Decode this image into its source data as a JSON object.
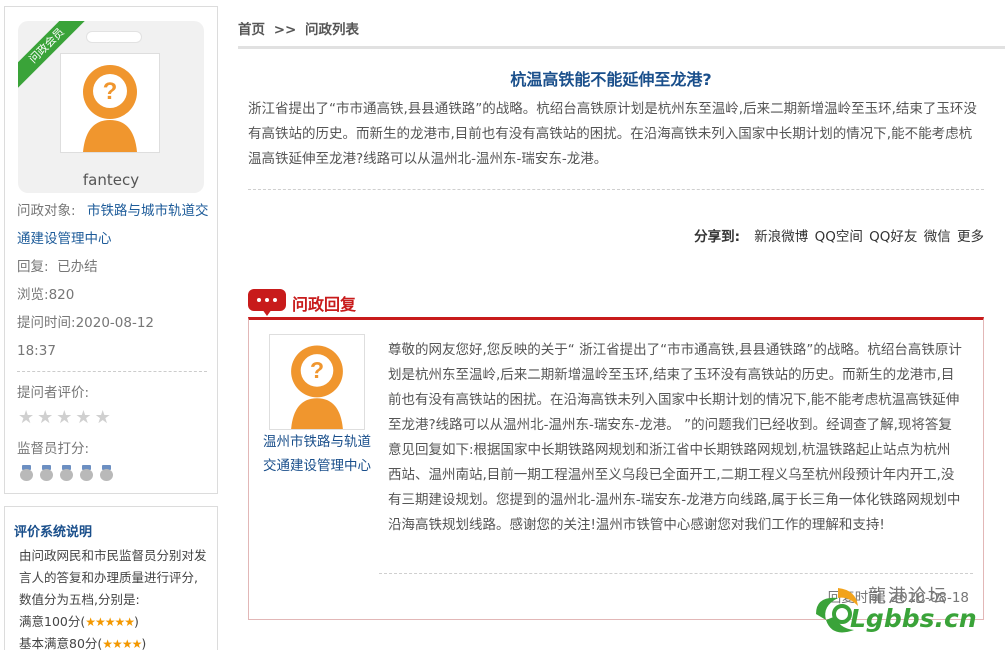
{
  "profile": {
    "badge": "问政会员",
    "username": "fantecy",
    "target_label": "问政对象:",
    "target_value": "市铁路与城市轨道交通建设管理中心",
    "reply_label": "回复:",
    "reply_value": "已办结",
    "views_label": "浏览:",
    "views_value": "820",
    "time_label": "提问时间:",
    "time_value": "2020-08-12 18:37",
    "asker_rating_label": "提问者评价:",
    "supervisor_rating_label": "监督员打分:"
  },
  "rules": {
    "title": "评价系统说明",
    "lines": [
      "由问政网民和市民监督员分别对发",
      "言人的答复和办理质量进行评分,",
      "数值分为五档,分别是:",
      "满意100分(★★★★★)",
      "基本满意80分(★★★★)"
    ]
  },
  "breadcrumb": {
    "home": "首页",
    "sep": ">>",
    "current": "问政列表"
  },
  "question": {
    "title": "杭温高铁能不能延伸至龙港?",
    "body": "浙江省提出了“市市通高铁,县县通铁路”的战略。杭绍台高铁原计划是杭州东至温岭,后来二期新增温岭至玉环,结束了玉环没有高铁站的历史。而新生的龙港市,目前也有没有高铁站的困扰。在沿海高铁未列入国家中长期计划的情况下,能不能考虑杭温高铁延伸至龙港?线路可以从温州北-温州东-瑞安东-龙港。"
  },
  "share": {
    "label": "分享到:",
    "items": [
      "新浪微博",
      "QQ空间",
      "QQ好友",
      "微信",
      "更多"
    ]
  },
  "reply": {
    "heading": "问政回复",
    "org_name": "温州市铁路与轨道交通建设管理中心",
    "body": "尊敬的网友您好,您反映的关于“ 浙江省提出了“市市通高铁,县县通铁路”的战略。杭绍台高铁原计划是杭州东至温岭,后来二期新增温岭至玉环,结束了玉环没有高铁站的历史。而新生的龙港市,目前也有没有高铁站的困扰。在沿海高铁未列入国家中长期计划的情况下,能不能考虑杭温高铁延伸至龙港?线路可以从温州北-温州东-瑞安东-龙港。 ”的问题我们已经收到。经调查了解,现将答复意见回复如下:根据国家中长期铁路网规划和浙江省中长期铁路网规划,杭温铁路起止站点为杭州西站、温州南站,目前一期工程温州至义乌段已全面开工,二期工程义乌至杭州段预计年内开工,没有三期建设规划。您提到的温州北-温州东-瑞安东-龙港方向线路,属于长三角一体化铁路网规划中沿海高铁规划线路。感谢您的关注!温州市铁管中心感谢您对我们工作的理解和支持!",
    "time": "回复时间: 2020-08-18"
  },
  "watermark": {
    "text": "Lgbbs.cn",
    "cn": "龍港论坛"
  },
  "colors": {
    "link": "#1d5b99",
    "accent_red": "#c81b1b",
    "avatar_orange": "#f0962e",
    "badge_green": "#3aa339"
  }
}
